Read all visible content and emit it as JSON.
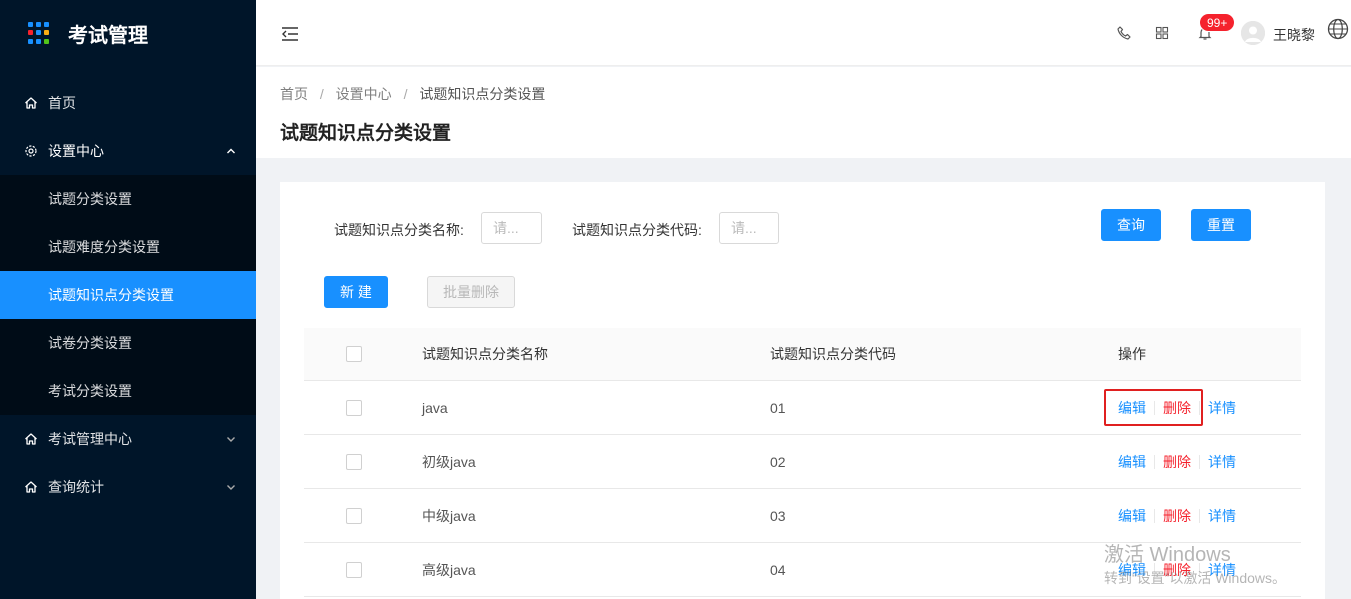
{
  "sidebar": {
    "title": "考试管理",
    "logo_colors": [
      "#1890ff",
      "#1890ff",
      "#1890ff",
      "#f5222d",
      "#1890ff",
      "#faad14",
      "#1890ff",
      "#1890ff",
      "#52c41a"
    ],
    "menu": {
      "home": "首页",
      "settings": "设置中心",
      "exam_mgmt": "考试管理中心",
      "query_stats": "查询统计"
    },
    "submenu": {
      "item1": "试题分类设置",
      "item2": "试题难度分类设置",
      "item3": "试题知识点分类设置",
      "item4": "试卷分类设置",
      "item5": "考试分类设置"
    }
  },
  "header": {
    "notification_count": "99+",
    "username": "王晓黎"
  },
  "breadcrumb": {
    "home": "首页",
    "settings": "设置中心",
    "current": "试题知识点分类设置",
    "separator": "/"
  },
  "page_title": "试题知识点分类设置",
  "search": {
    "name_label": "试题知识点分类名称:",
    "name_placeholder": "请...",
    "code_label": "试题知识点分类代码:",
    "code_placeholder": "请...",
    "query_button": "查询",
    "reset_button": "重置"
  },
  "actions": {
    "new_button": "新 建",
    "batch_delete_button": "批量删除"
  },
  "table": {
    "columns": {
      "name": "试题知识点分类名称",
      "code": "试题知识点分类代码",
      "ops": "操作"
    },
    "op_labels": {
      "edit": "编辑",
      "delete": "删除",
      "detail": "详情"
    },
    "rows": [
      {
        "name": "java",
        "code": "01"
      },
      {
        "name": "初级java",
        "code": "02"
      },
      {
        "name": "中级java",
        "code": "03"
      },
      {
        "name": "高级java",
        "code": "04"
      }
    ]
  },
  "watermark": {
    "line1": "激活 Windows",
    "line2": "转到“设置”以激活 Windows。"
  }
}
